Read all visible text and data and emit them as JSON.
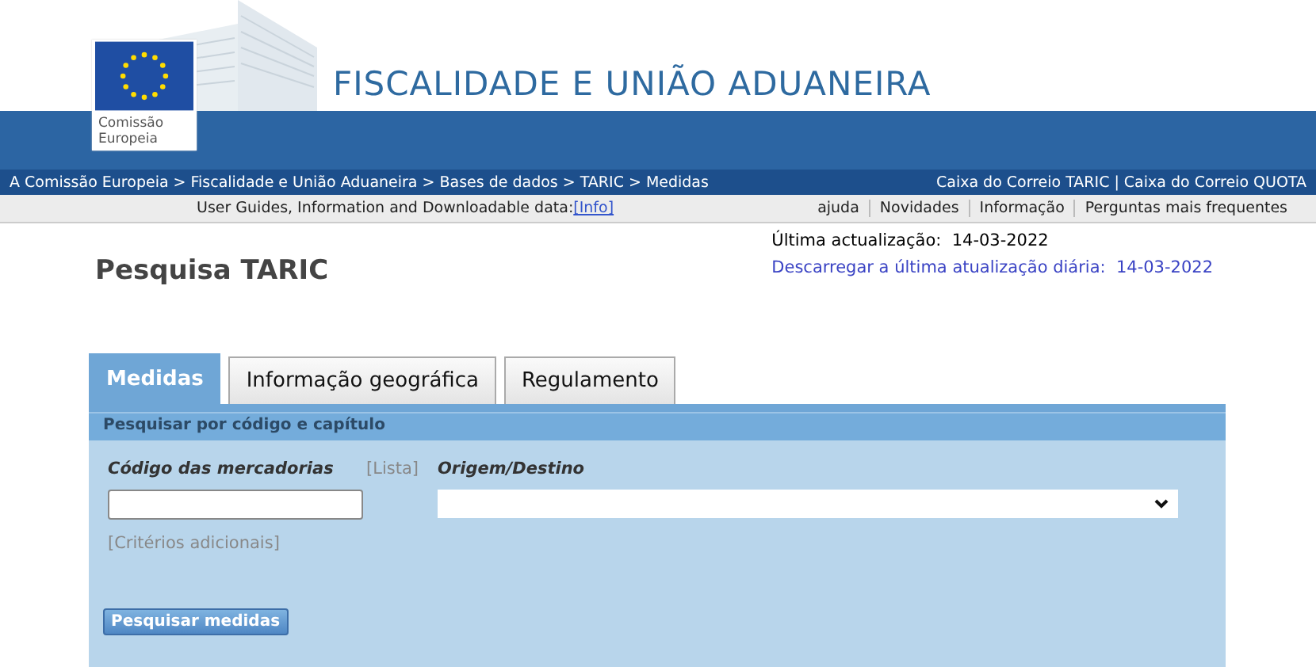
{
  "header": {
    "logo_text": "Comissão Europeia",
    "title": "FISCALIDADE E UNIÃO ADUANEIRA"
  },
  "breadcrumb": {
    "items": [
      "A Comissão Europeia",
      "Fiscalidade e União Aduaneira",
      "Bases de dados",
      "TARIC",
      "Medidas"
    ],
    "separator": ">"
  },
  "mailboxes": {
    "items": [
      "Caixa do Correio TARIC",
      "Caixa do Correio QUOTA"
    ],
    "separator": "|"
  },
  "info_bar": {
    "text": "User Guides, Information and Downloadable data:",
    "link": "[Info]",
    "links": [
      "ajuda",
      "Novidades",
      "Informação",
      "Perguntas mais frequentes"
    ]
  },
  "page_title": "Pesquisa TARIC",
  "updates": {
    "last_update": "Última actualização:  14-03-2022",
    "download_link": "Descarregar a última atualização diária:  14-03-2022"
  },
  "tabs": [
    {
      "label": "Medidas",
      "selected": true
    },
    {
      "label": "Informação geográfica",
      "selected": false
    },
    {
      "label": "Regulamento",
      "selected": false
    }
  ],
  "panel": {
    "heading": "Pesquisar por código e capítulo",
    "code_label": "Código das mercadorias",
    "list_link": "[Lista]",
    "origin_label": "Origem/Destino",
    "extra_link": "[Critérios adicionais]",
    "search_button": "Pesquisar medidas"
  }
}
